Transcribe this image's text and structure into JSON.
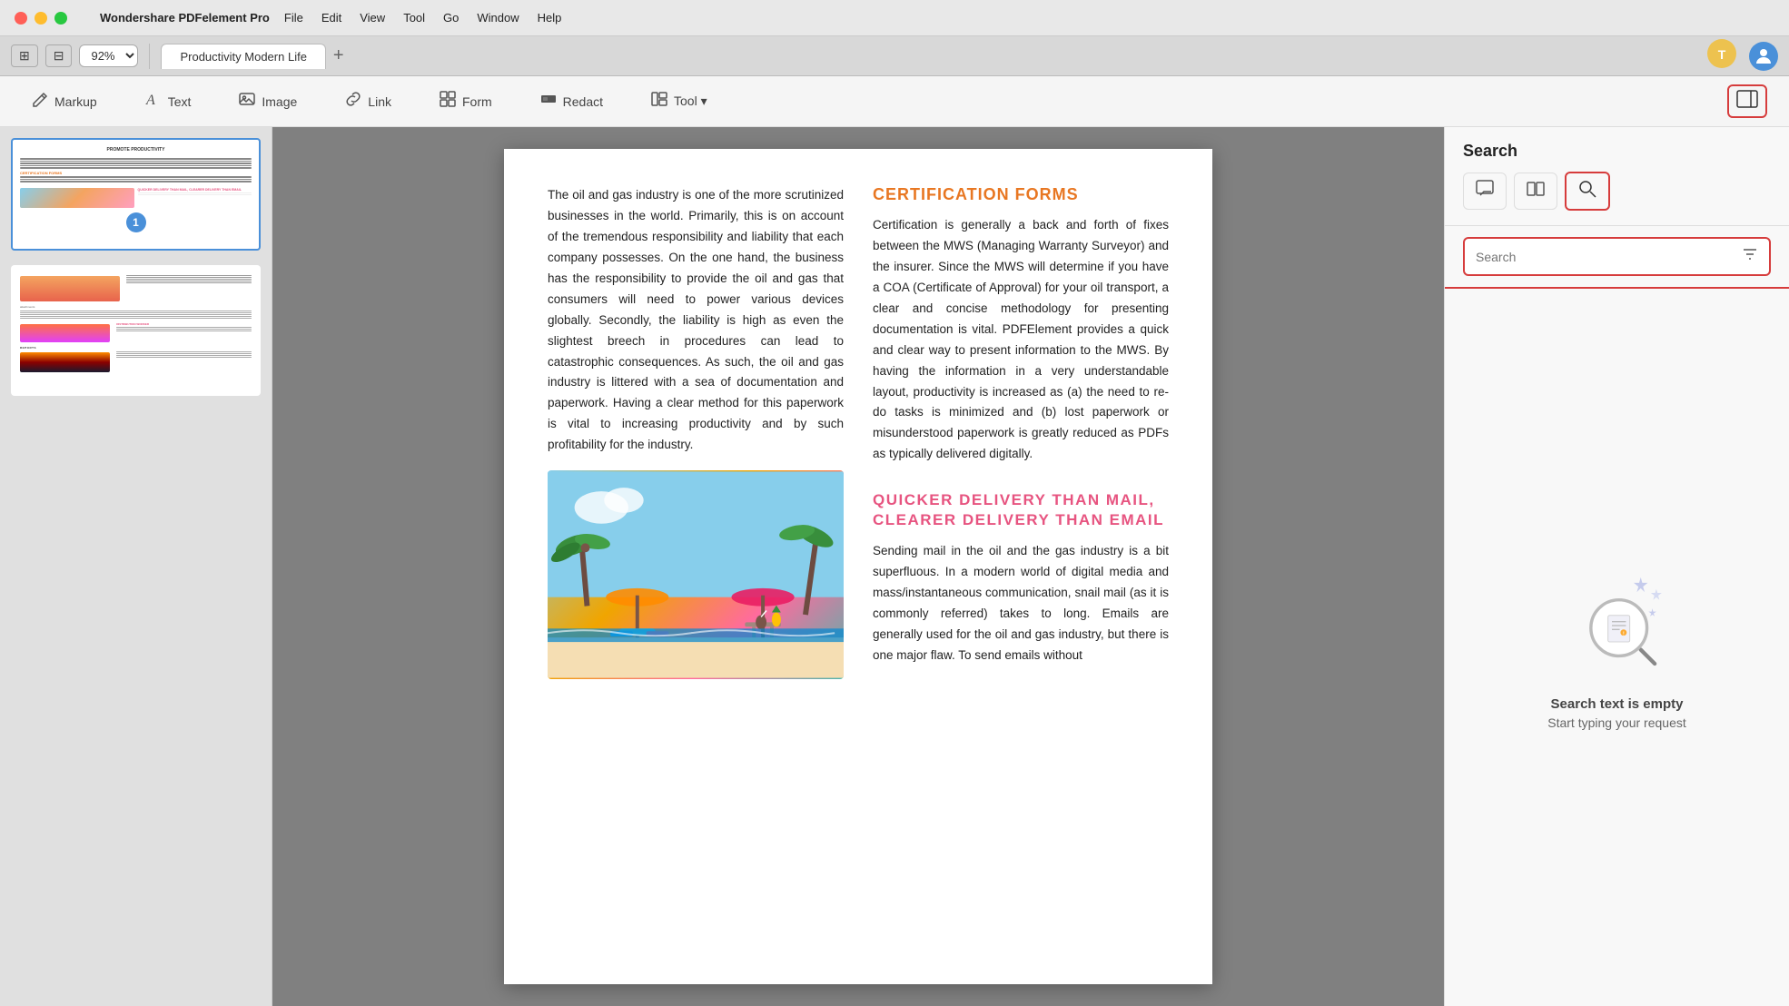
{
  "titlebar": {
    "apple_logo": "",
    "app_name": "Wondershare PDFelement Pro",
    "menu_items": [
      "File",
      "Edit",
      "View",
      "Tool",
      "Go",
      "Window",
      "Help"
    ]
  },
  "tabbar": {
    "zoom": "92%",
    "tab_title": "Productivity Modern Life",
    "tab_plus": "+",
    "tips_icon": "⊛",
    "user_icon": "👤"
  },
  "toolbar": {
    "tools": [
      {
        "icon": "✏️",
        "label": "Markup"
      },
      {
        "icon": "A",
        "label": "Text"
      },
      {
        "icon": "🖼",
        "label": "Image"
      },
      {
        "icon": "🔗",
        "label": "Link"
      },
      {
        "icon": "⊞",
        "label": "Form"
      },
      {
        "icon": "⬛",
        "label": "Redact"
      },
      {
        "icon": "🔧",
        "label": "Tool ▾"
      }
    ],
    "panel_toggle": "⊟"
  },
  "sidebar": {
    "page1": {
      "badge": "1"
    },
    "page2": {}
  },
  "document": {
    "left_col_text": "The oil and gas industry is one of the more scrutinized businesses in the world. Primarily, this is on account of the tremendous responsibility and liability that each company possesses. On the one hand, the business has the responsibility to provide the oil and gas that consumers will need to power various devices globally. Secondly, the liability is high as even the slightest breech in procedures can lead to catastrophic consequences. As such, the oil and gas industry is littered with a sea of documentation and paperwork. Having a clear method for this paperwork is vital to increasing productivity and by such profitability for the industry.",
    "right_heading": "CERTIFICATION FORMS",
    "right_col_text": "Certification is generally a back and forth of fixes between the MWS (Managing Warranty Surveyor) and the insurer. Since the MWS will determine if you have a COA (Certificate of Approval) for your oil transport, a clear and concise methodology for presenting documentation is vital. PDFElement provides a quick and clear way to present information to the MWS. By having the information in a very understandable layout, productivity is increased as (a) the need to re-do tasks is minimized and (b) lost paperwork or misunderstood paperwork is greatly reduced as PDFs as typically delivered digitally.",
    "lower_heading": "QUICKER DELIVERY THAN MAIL, CLEARER DELIVERY THAN EMAIL",
    "lower_text": "Sending mail in the oil and the gas industry is a bit superfluous. In a modern world of digital media and mass/instantaneous communication, snail mail (as it is commonly referred) takes to long. Emails are generally used for the oil and gas industry, but there is one major flaw. To send emails without"
  },
  "right_panel": {
    "title": "Search",
    "search_placeholder": "Search",
    "empty_title": "Search text is empty",
    "empty_subtitle": "Start typing your request",
    "tool_icons": [
      "☰",
      "⚌",
      "🔍"
    ]
  }
}
